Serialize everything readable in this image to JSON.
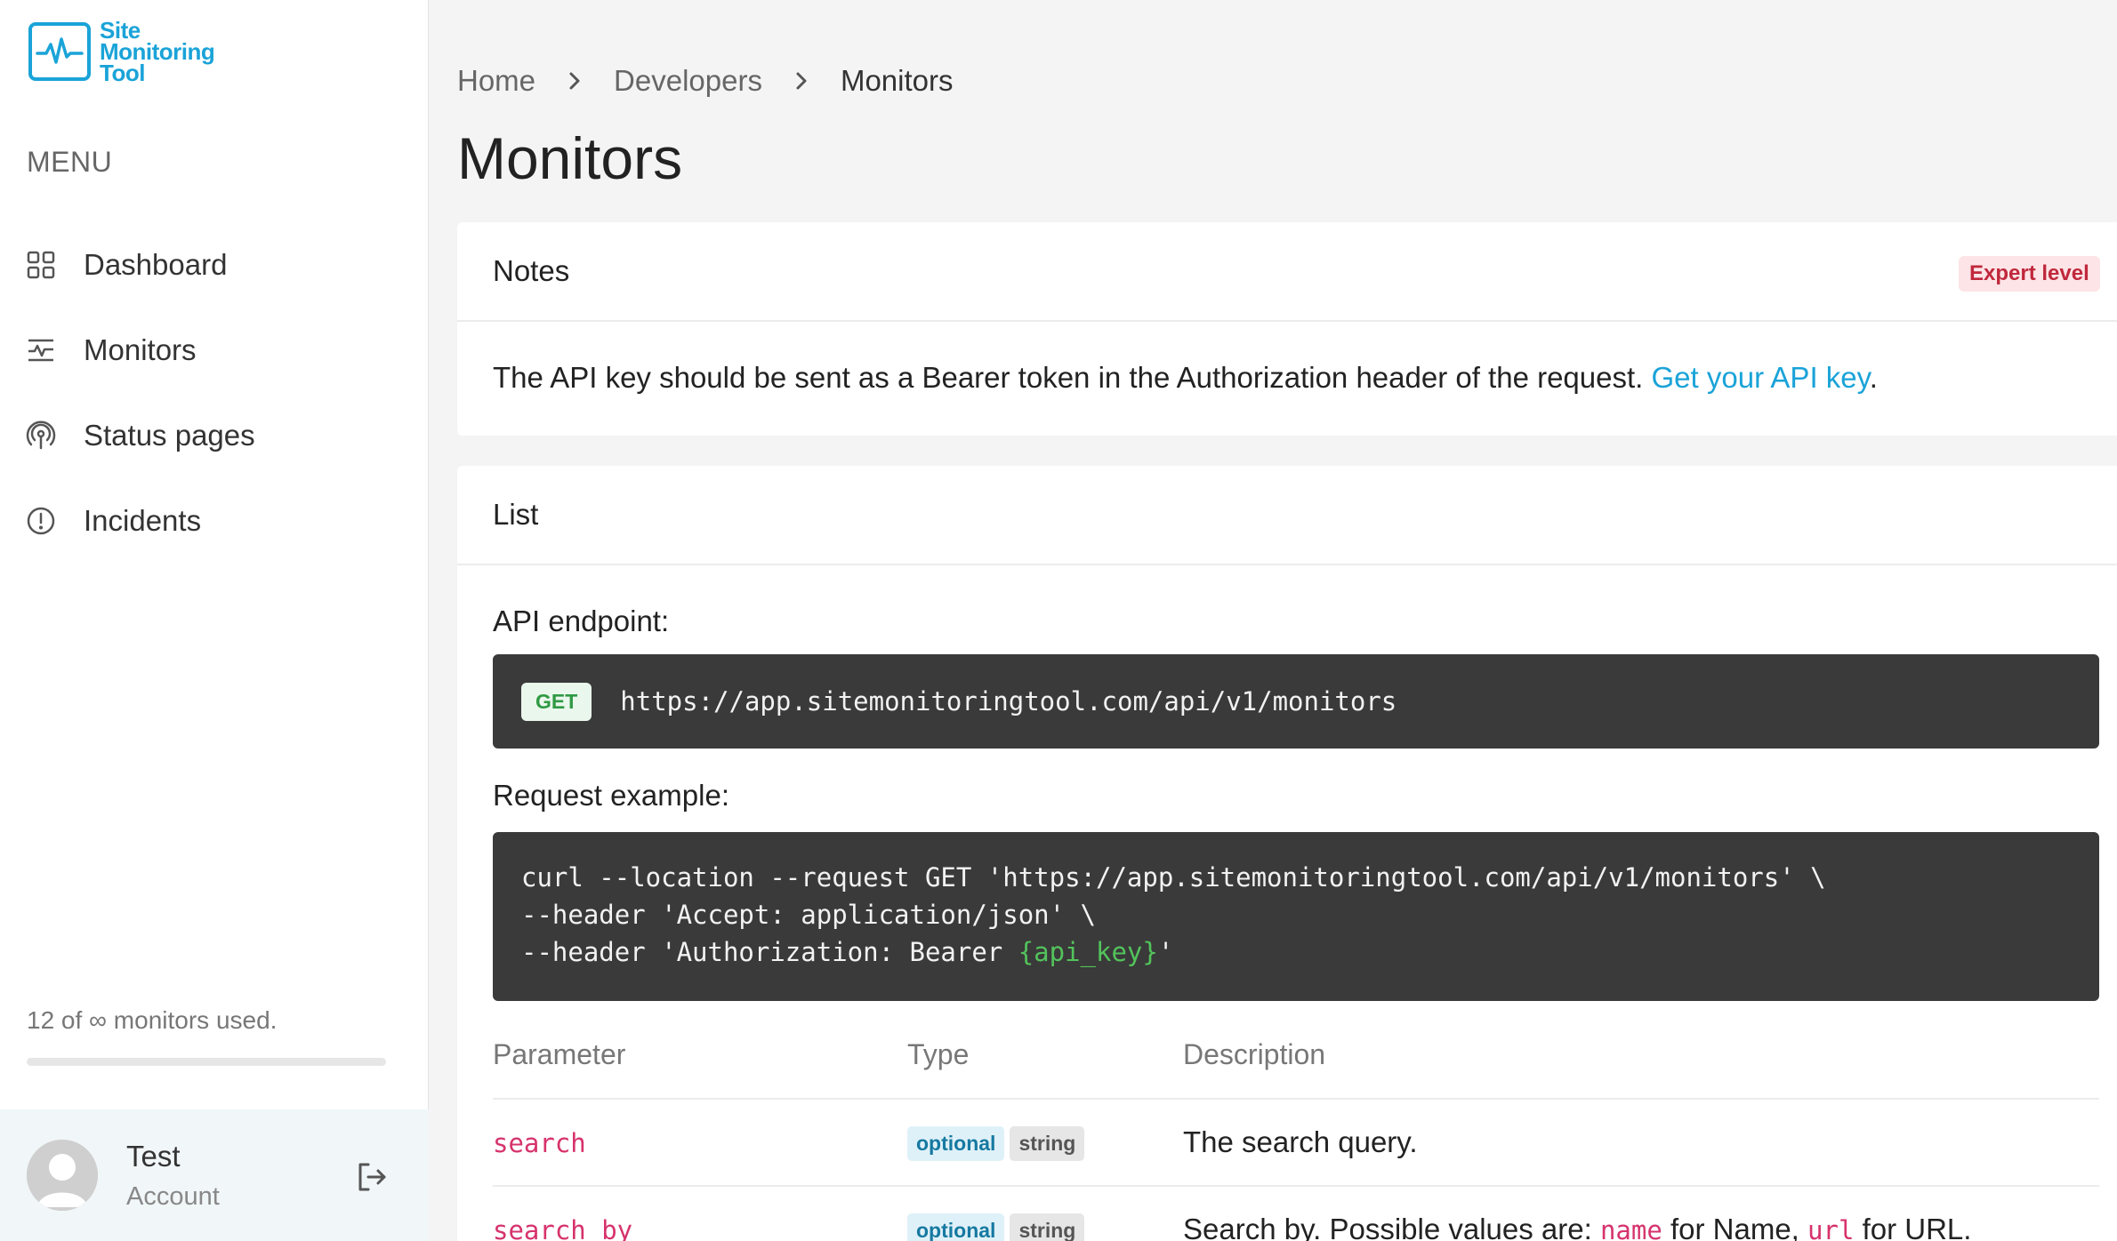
{
  "app": {
    "logo_lines": [
      "Site",
      "Monitoring",
      "Tool"
    ],
    "brand_color": "#1aa3d8"
  },
  "sidebar": {
    "menu_label": "MENU",
    "items": [
      {
        "label": "Dashboard",
        "icon": "grid-icon"
      },
      {
        "label": "Monitors",
        "icon": "monitor-pulse-icon"
      },
      {
        "label": "Status pages",
        "icon": "broadcast-icon"
      },
      {
        "label": "Incidents",
        "icon": "alert-circle-icon"
      }
    ],
    "usage_text": "12 of ∞ monitors used.",
    "usage_fraction": 0,
    "account": {
      "name": "Test",
      "sub": "Account"
    }
  },
  "breadcrumb": {
    "items": [
      "Home",
      "Developers",
      "Monitors"
    ]
  },
  "page": {
    "title": "Monitors"
  },
  "notes": {
    "title": "Notes",
    "badge": "Expert level",
    "text": "The API key should be sent as a Bearer token in the Authorization header of the request. ",
    "link_text": "Get your API key",
    "text_after": "."
  },
  "list": {
    "title": "List",
    "endpoint_label": "API endpoint:",
    "method": "GET",
    "endpoint_url": "https://app.sitemonitoringtool.com/api/v1/monitors",
    "request_label": "Request example:",
    "request_lines": {
      "line1": "curl --location --request GET 'https://app.sitemonitoringtool.com/api/v1/monitors' \\",
      "line2": "--header 'Accept: application/json' \\",
      "line3_prefix": "--header 'Authorization: Bearer ",
      "line3_var": "{api_key}",
      "line3_suffix": "'"
    },
    "table": {
      "headers": [
        "Parameter",
        "Type",
        "Description"
      ],
      "rows": [
        {
          "name": "search",
          "optional": "optional",
          "type": "string",
          "description": "The search query."
        },
        {
          "name": "search_by",
          "optional": "optional",
          "type": "string",
          "description_prefix": "Search by. Possible values are: ",
          "code1": "name",
          "mid1": " for Name, ",
          "code2": "url",
          "mid2": " for URL."
        }
      ]
    }
  }
}
